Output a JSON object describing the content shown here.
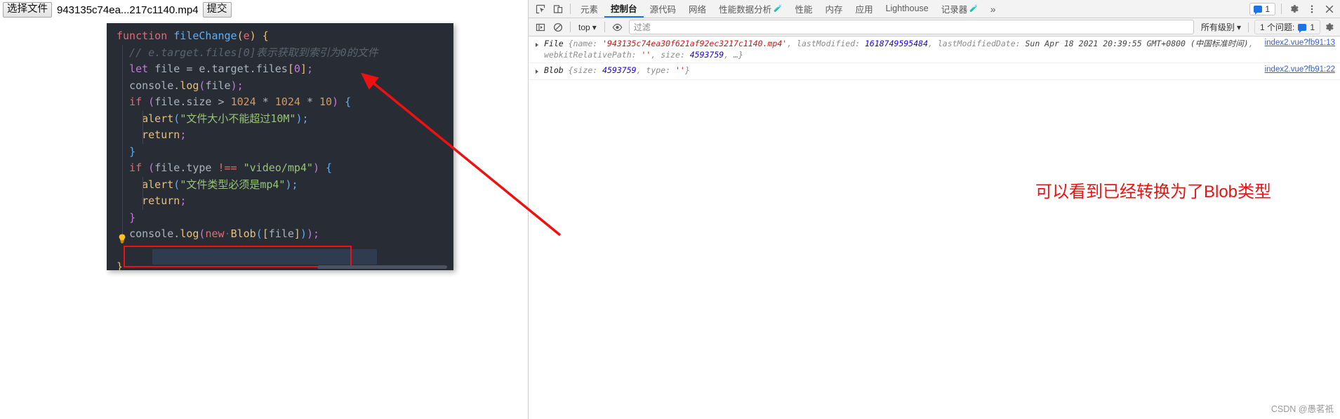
{
  "page": {
    "upload": {
      "choose_file_label": "选择文件",
      "file_name": "943135c74ea...217c1140.mp4",
      "submit_label": "提交"
    }
  },
  "code": {
    "language": "javascript",
    "lines": [
      {
        "tokens": [
          {
            "t": "function",
            "c": "t-kw2"
          },
          {
            "t": " ",
            "c": "t-plain"
          },
          {
            "t": "fileChange",
            "c": "t-fn"
          },
          {
            "t": "(",
            "c": "t-brace-y"
          },
          {
            "t": "e",
            "c": "t-var"
          },
          {
            "t": ")",
            "c": "t-brace-y"
          },
          {
            "t": " ",
            "c": "t-plain"
          },
          {
            "t": "{",
            "c": "t-brace-y"
          }
        ]
      },
      {
        "indent": 1,
        "tokens": [
          {
            "t": "  // e.target.files[0]表示获取到索引为0的文件",
            "c": "t-cmt"
          }
        ]
      },
      {
        "indent": 1,
        "tokens": [
          {
            "t": "  ",
            "c": "t-plain"
          },
          {
            "t": "let",
            "c": "t-kw"
          },
          {
            "t": " ",
            "c": "t-plain"
          },
          {
            "t": "file",
            "c": "t-plain"
          },
          {
            "t": " ",
            "c": "t-plain"
          },
          {
            "t": "=",
            "c": "t-plain"
          },
          {
            "t": " ",
            "c": "t-plain"
          },
          {
            "t": "e",
            "c": "t-plain"
          },
          {
            "t": ".",
            "c": "t-plain"
          },
          {
            "t": "target",
            "c": "t-plain"
          },
          {
            "t": ".",
            "c": "t-plain"
          },
          {
            "t": "files",
            "c": "t-plain"
          },
          {
            "t": "[",
            "c": "t-brace-y"
          },
          {
            "t": "0",
            "c": "t-brace-p"
          },
          {
            "t": "]",
            "c": "t-brace-y"
          },
          {
            "t": ";",
            "c": "t-brace-p"
          }
        ]
      },
      {
        "indent": 1,
        "tokens": [
          {
            "t": "  ",
            "c": "t-plain"
          },
          {
            "t": "console",
            "c": "t-plain"
          },
          {
            "t": ".",
            "c": "t-plain"
          },
          {
            "t": "log",
            "c": "t-fname"
          },
          {
            "t": "(",
            "c": "t-brace-p"
          },
          {
            "t": "file",
            "c": "t-plain"
          },
          {
            "t": ")",
            "c": "t-brace-p"
          },
          {
            "t": ";",
            "c": "t-brace-p"
          }
        ]
      },
      {
        "indent": 1,
        "tokens": [
          {
            "t": "  ",
            "c": "t-plain"
          },
          {
            "t": "if",
            "c": "t-kw2"
          },
          {
            "t": " ",
            "c": "t-plain"
          },
          {
            "t": "(",
            "c": "t-brace-p"
          },
          {
            "t": "file",
            "c": "t-plain"
          },
          {
            "t": ".",
            "c": "t-plain"
          },
          {
            "t": "size",
            "c": "t-plain"
          },
          {
            "t": " ",
            "c": "t-plain"
          },
          {
            "t": ">",
            "c": "t-plain"
          },
          {
            "t": " ",
            "c": "t-plain"
          },
          {
            "t": "1024",
            "c": "t-num"
          },
          {
            "t": " ",
            "c": "t-plain"
          },
          {
            "t": "*",
            "c": "t-plain"
          },
          {
            "t": " ",
            "c": "t-plain"
          },
          {
            "t": "1024",
            "c": "t-num"
          },
          {
            "t": " ",
            "c": "t-plain"
          },
          {
            "t": "*",
            "c": "t-plain"
          },
          {
            "t": " ",
            "c": "t-plain"
          },
          {
            "t": "10",
            "c": "t-num"
          },
          {
            "t": ")",
            "c": "t-brace-p"
          },
          {
            "t": " ",
            "c": "t-plain"
          },
          {
            "t": "{",
            "c": "t-brace-b"
          }
        ]
      },
      {
        "indent": 2,
        "tokens": [
          {
            "t": "    ",
            "c": "t-plain"
          },
          {
            "t": "alert",
            "c": "t-ret"
          },
          {
            "t": "(",
            "c": "t-brace-b"
          },
          {
            "t": "\"文件大小不能超过10M\"",
            "c": "t-str"
          },
          {
            "t": ")",
            "c": "t-brace-b"
          },
          {
            "t": ";",
            "c": "t-brace-b"
          }
        ]
      },
      {
        "indent": 2,
        "tokens": [
          {
            "t": "    ",
            "c": "t-plain"
          },
          {
            "t": "return",
            "c": "t-ret"
          },
          {
            "t": ";",
            "c": "t-brace-p"
          }
        ]
      },
      {
        "indent": 1,
        "tokens": [
          {
            "t": "  ",
            "c": "t-plain"
          },
          {
            "t": "}",
            "c": "t-brace-b"
          }
        ]
      },
      {
        "indent": 1,
        "tokens": [
          {
            "t": "  ",
            "c": "t-plain"
          },
          {
            "t": "if",
            "c": "t-kw2"
          },
          {
            "t": " ",
            "c": "t-plain"
          },
          {
            "t": "(",
            "c": "t-brace-p"
          },
          {
            "t": "file",
            "c": "t-plain"
          },
          {
            "t": ".",
            "c": "t-plain"
          },
          {
            "t": "type",
            "c": "t-plain"
          },
          {
            "t": " ",
            "c": "t-plain"
          },
          {
            "t": "!==",
            "c": "t-kw2"
          },
          {
            "t": " ",
            "c": "t-plain"
          },
          {
            "t": "\"video/mp4\"",
            "c": "t-str"
          },
          {
            "t": ")",
            "c": "t-brace-p"
          },
          {
            "t": " ",
            "c": "t-plain"
          },
          {
            "t": "{",
            "c": "t-brace-b"
          }
        ]
      },
      {
        "indent": 2,
        "tokens": [
          {
            "t": "    ",
            "c": "t-plain"
          },
          {
            "t": "alert",
            "c": "t-ret"
          },
          {
            "t": "(",
            "c": "t-brace-b"
          },
          {
            "t": "\"文件类型必须是mp4\"",
            "c": "t-str"
          },
          {
            "t": ")",
            "c": "t-brace-b"
          },
          {
            "t": ";",
            "c": "t-brace-b"
          }
        ]
      },
      {
        "indent": 2,
        "tokens": [
          {
            "t": "    ",
            "c": "t-plain"
          },
          {
            "t": "return",
            "c": "t-ret"
          },
          {
            "t": ";",
            "c": "t-brace-p"
          }
        ]
      },
      {
        "indent": 1,
        "tokens": [
          {
            "t": "  ",
            "c": "t-plain"
          },
          {
            "t": "}",
            "c": "t-brace-p"
          }
        ]
      },
      {
        "indent": 1,
        "highlighted": true,
        "tokens": [
          {
            "t": "  ",
            "c": "t-plain"
          },
          {
            "t": "console",
            "c": "t-plain"
          },
          {
            "t": ".",
            "c": "t-plain"
          },
          {
            "t": "log",
            "c": "t-fname"
          },
          {
            "t": "(",
            "c": "t-brace-p"
          },
          {
            "t": "new",
            "c": "t-kw2"
          },
          {
            "t": "·",
            "c": "t-cmt"
          },
          {
            "t": "Blob",
            "c": "t-fname"
          },
          {
            "t": "(",
            "c": "t-brace-b"
          },
          {
            "t": "[",
            "c": "t-brace-y"
          },
          {
            "t": "file",
            "c": "t-plain"
          },
          {
            "t": "]",
            "c": "t-brace-y"
          },
          {
            "t": ")",
            "c": "t-brace-b"
          },
          {
            "t": ")",
            "c": "t-brace-p"
          },
          {
            "t": ";",
            "c": "t-brace-p"
          }
        ]
      },
      {
        "tokens": []
      },
      {
        "tokens": [
          {
            "t": "}",
            "c": "t-brace-y"
          }
        ]
      }
    ]
  },
  "annotation": {
    "text": "可以看到已经转换为了Blob类型",
    "color": "#ee1111"
  },
  "devtools": {
    "tabs": [
      {
        "label": "元素",
        "active": false,
        "experimental": false
      },
      {
        "label": "控制台",
        "active": true,
        "experimental": false
      },
      {
        "label": "源代码",
        "active": false,
        "experimental": false
      },
      {
        "label": "网络",
        "active": false,
        "experimental": false
      },
      {
        "label": "性能数据分析",
        "active": false,
        "experimental": true
      },
      {
        "label": "性能",
        "active": false,
        "experimental": false
      },
      {
        "label": "内存",
        "active": false,
        "experimental": false
      },
      {
        "label": "应用",
        "active": false,
        "experimental": false
      },
      {
        "label": "Lighthouse",
        "active": false,
        "experimental": false
      },
      {
        "label": "记录器",
        "active": false,
        "experimental": true
      }
    ],
    "more_tabs_label": "»",
    "issues_badge_count": "1",
    "toolbar": {
      "context_label": "top",
      "filter_placeholder": "过滤",
      "level_label": "所有级别",
      "issues_label": "1 个问题:",
      "issues_value": "1"
    },
    "console_logs": [
      {
        "expandable": true,
        "source": "index2.vue?fb91:13",
        "segments": [
          {
            "text": "File ",
            "kind": "ctor"
          },
          {
            "text": "{name: ",
            "kind": "key"
          },
          {
            "text": "'943135c74ea30f621af92ec3217c1140.mp4'",
            "kind": "string"
          },
          {
            "text": ", lastModified: ",
            "kind": "key"
          },
          {
            "text": "1618749595484",
            "kind": "number"
          },
          {
            "text": ", lastModifiedDate: ",
            "kind": "key"
          },
          {
            "text": "Sun Apr 18 2021 20:39:55 GMT+0800 (中国标准时间)",
            "kind": "other"
          },
          {
            "text": ", webkitRelativePath: ",
            "kind": "key"
          },
          {
            "text": "''",
            "kind": "string"
          },
          {
            "text": ", size: ",
            "kind": "key"
          },
          {
            "text": "4593759",
            "kind": "number"
          },
          {
            "text": ", …}",
            "kind": "key"
          }
        ]
      },
      {
        "expandable": true,
        "source": "index2.vue?fb91:22",
        "segments": [
          {
            "text": "Blob ",
            "kind": "ctor"
          },
          {
            "text": "{size: ",
            "kind": "key"
          },
          {
            "text": "4593759",
            "kind": "number"
          },
          {
            "text": ", type: ",
            "kind": "key"
          },
          {
            "text": "''",
            "kind": "string"
          },
          {
            "text": "}",
            "kind": "key"
          }
        ]
      }
    ]
  },
  "watermark": "CSDN @愚茗祇"
}
